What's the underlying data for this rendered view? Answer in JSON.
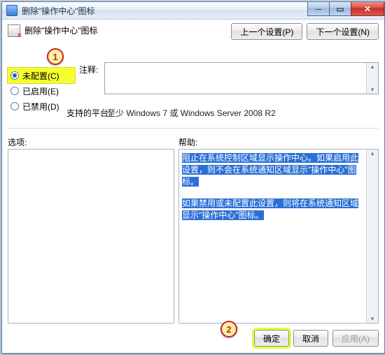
{
  "window": {
    "title": "删除\"操作中心\"图标"
  },
  "header": {
    "title": "删除\"操作中心\"图标"
  },
  "nav": {
    "prev": "上一个设置(P)",
    "next": "下一个设置(N)"
  },
  "radios": {
    "not_configured": "未配置(C)",
    "enabled": "已启用(E)",
    "disabled": "已禁用(D)"
  },
  "labels": {
    "comment": "注释:",
    "platform": "支持的平台:",
    "options": "选项:",
    "help": "帮助:"
  },
  "platform_value": "至少 Windows 7 或 Windows Server 2008 R2",
  "help_text": {
    "p1": "阻止在系统控制区域显示操作中心。如果启用此设置，则不会在系统通知区域显示\"操作中心\"图标。",
    "p2": "如果禁用或未配置此设置，则将在系统通知区域显示\"操作中心\"图标。"
  },
  "footer": {
    "ok": "确定",
    "cancel": "取消",
    "apply": "应用(A)"
  },
  "callouts": {
    "one": "1",
    "two": "2"
  }
}
